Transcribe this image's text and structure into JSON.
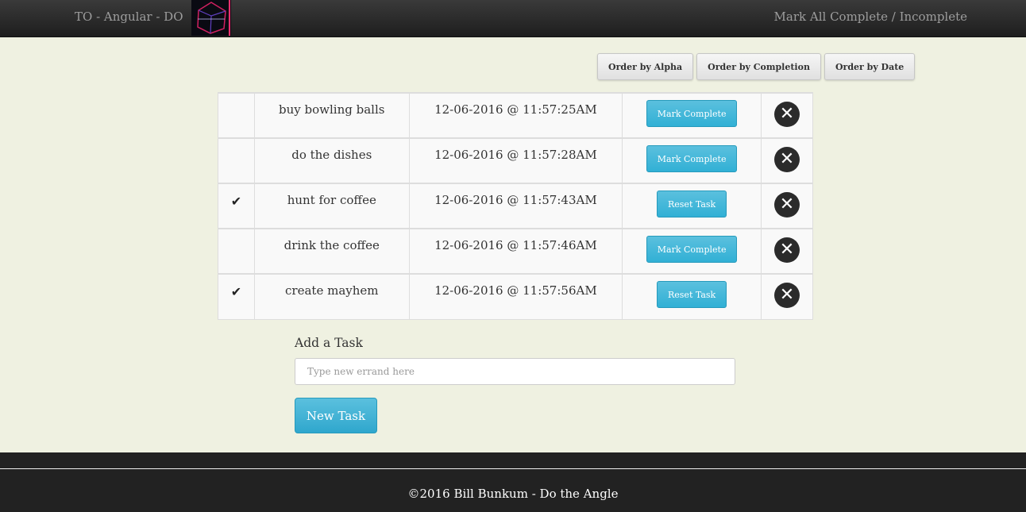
{
  "navbar": {
    "brand": "TO - Angular - DO",
    "toggle_all_label": "Mark All Complete / Incomplete"
  },
  "sort": {
    "alpha_label": "Order by Alpha",
    "completion_label": "Order by Completion",
    "date_label": "Order by Date"
  },
  "tasks": [
    {
      "name": "buy bowling balls",
      "date": "12-06-2016 @ 11:57:25AM",
      "completed": false,
      "action_label": "Mark Complete"
    },
    {
      "name": "do the dishes",
      "date": "12-06-2016 @ 11:57:28AM",
      "completed": false,
      "action_label": "Mark Complete"
    },
    {
      "name": "hunt for coffee",
      "date": "12-06-2016 @ 11:57:43AM",
      "completed": true,
      "action_label": "Reset Task"
    },
    {
      "name": "drink the coffee",
      "date": "12-06-2016 @ 11:57:46AM",
      "completed": false,
      "action_label": "Mark Complete"
    },
    {
      "name": "create mayhem",
      "date": "12-06-2016 @ 11:57:56AM",
      "completed": true,
      "action_label": "Reset Task"
    }
  ],
  "icons": {
    "check": "checkmark-icon",
    "delete": "close-circle-icon",
    "check_glyph": "✔",
    "delete_glyph": "✕"
  },
  "add_task": {
    "label": "Add a Task",
    "placeholder": "Type new errand here",
    "value": "",
    "button_label": "New Task"
  },
  "footer": {
    "text": "©2016 Bill Bunkum - Do the Angle"
  },
  "colors": {
    "page_bg": "#eff1e1",
    "navbar_bg": "#2b2b2b",
    "info_button": "#5bc0de",
    "footer_bg": "#222222"
  }
}
